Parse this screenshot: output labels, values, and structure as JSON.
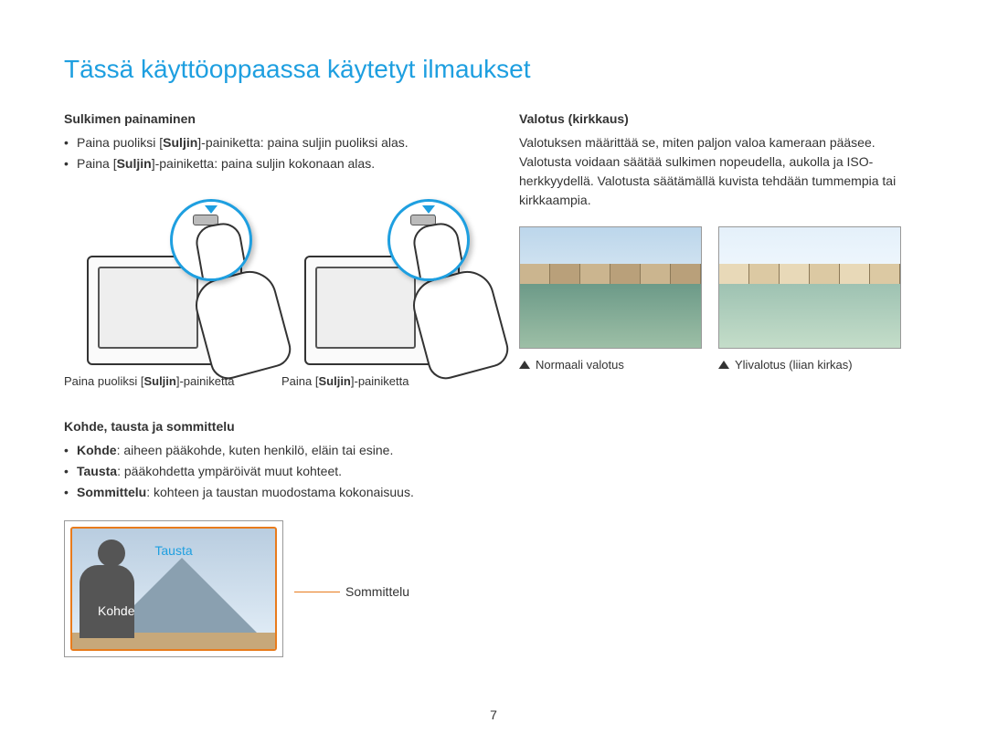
{
  "title": "Tässä käyttöoppaassa käytetyt ilmaukset",
  "left": {
    "sec1_heading": "Sulkimen painaminen",
    "bullet1_pre": "Paina puoliksi [",
    "bullet1_bold": "Suljin",
    "bullet1_post": "]-painiketta: paina suljin puoliksi alas.",
    "bullet2_pre": "Paina [",
    "bullet2_bold": "Suljin",
    "bullet2_post": "]-painiketta: paina suljin kokonaan alas.",
    "caption1_pre": "Paina puoliksi [",
    "caption1_bold": "Suljin",
    "caption1_post": "]-painiketta",
    "caption2_pre": "Paina [",
    "caption2_bold": "Suljin",
    "caption2_post": "]-painiketta",
    "sec2_heading": "Kohde, tausta ja sommittelu",
    "b_kohde_bold": "Kohde",
    "b_kohde_rest": ": aiheen pääkohde, kuten henkilö, eläin tai esine.",
    "b_tausta_bold": "Tausta",
    "b_tausta_rest": ": pääkohdetta ympäröivät muut kohteet.",
    "b_sommittelu_bold": "Sommittelu",
    "b_sommittelu_rest": ": kohteen ja taustan muodostama kokonaisuus.",
    "label_tausta": "Tausta",
    "label_kohde": "Kohde",
    "label_sommittelu": "Sommittelu"
  },
  "right": {
    "heading": "Valotus (kirkkaus)",
    "para": "Valotuksen määrittää se, miten paljon valoa kameraan pääsee. Valotusta voidaan säätää sulkimen nopeudella, aukolla ja ISO-herkkyydellä. Valotusta säätämällä kuvista tehdään tummempia tai kirkkaampia.",
    "cap_normal": "Normaali valotus",
    "cap_over": "Ylivalotus (liian kirkas)"
  },
  "page_number": "7"
}
